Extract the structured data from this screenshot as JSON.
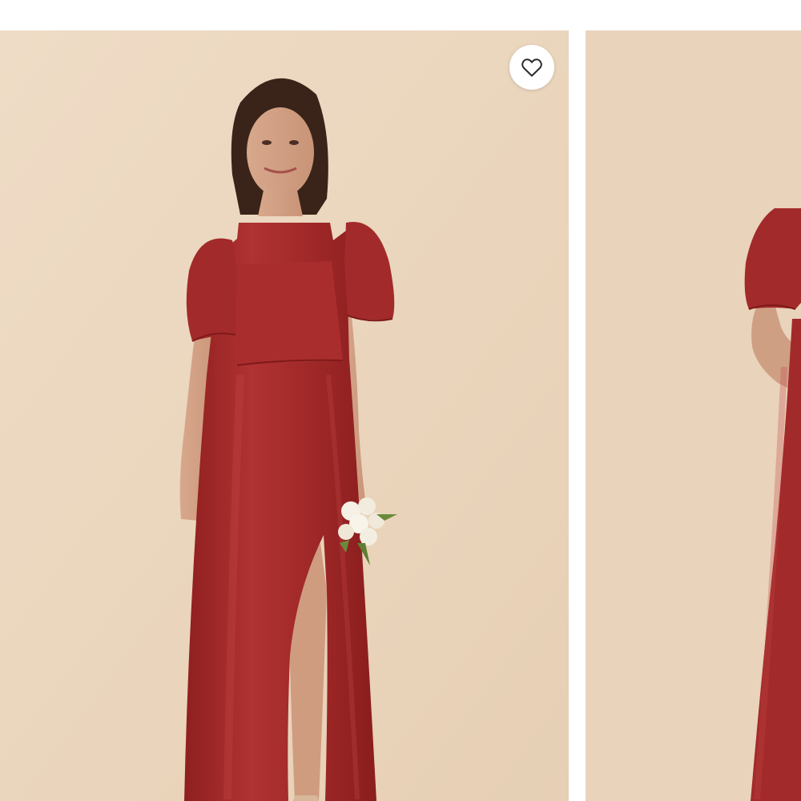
{
  "gallery": {
    "background_color": "#ead5bd",
    "dress_color": "#a32a2a",
    "images": [
      {
        "alt": ""
      },
      {
        "alt": ""
      }
    ]
  },
  "favorite": {
    "icon": "heart-outline-icon",
    "aria_label": "",
    "selected": false
  }
}
